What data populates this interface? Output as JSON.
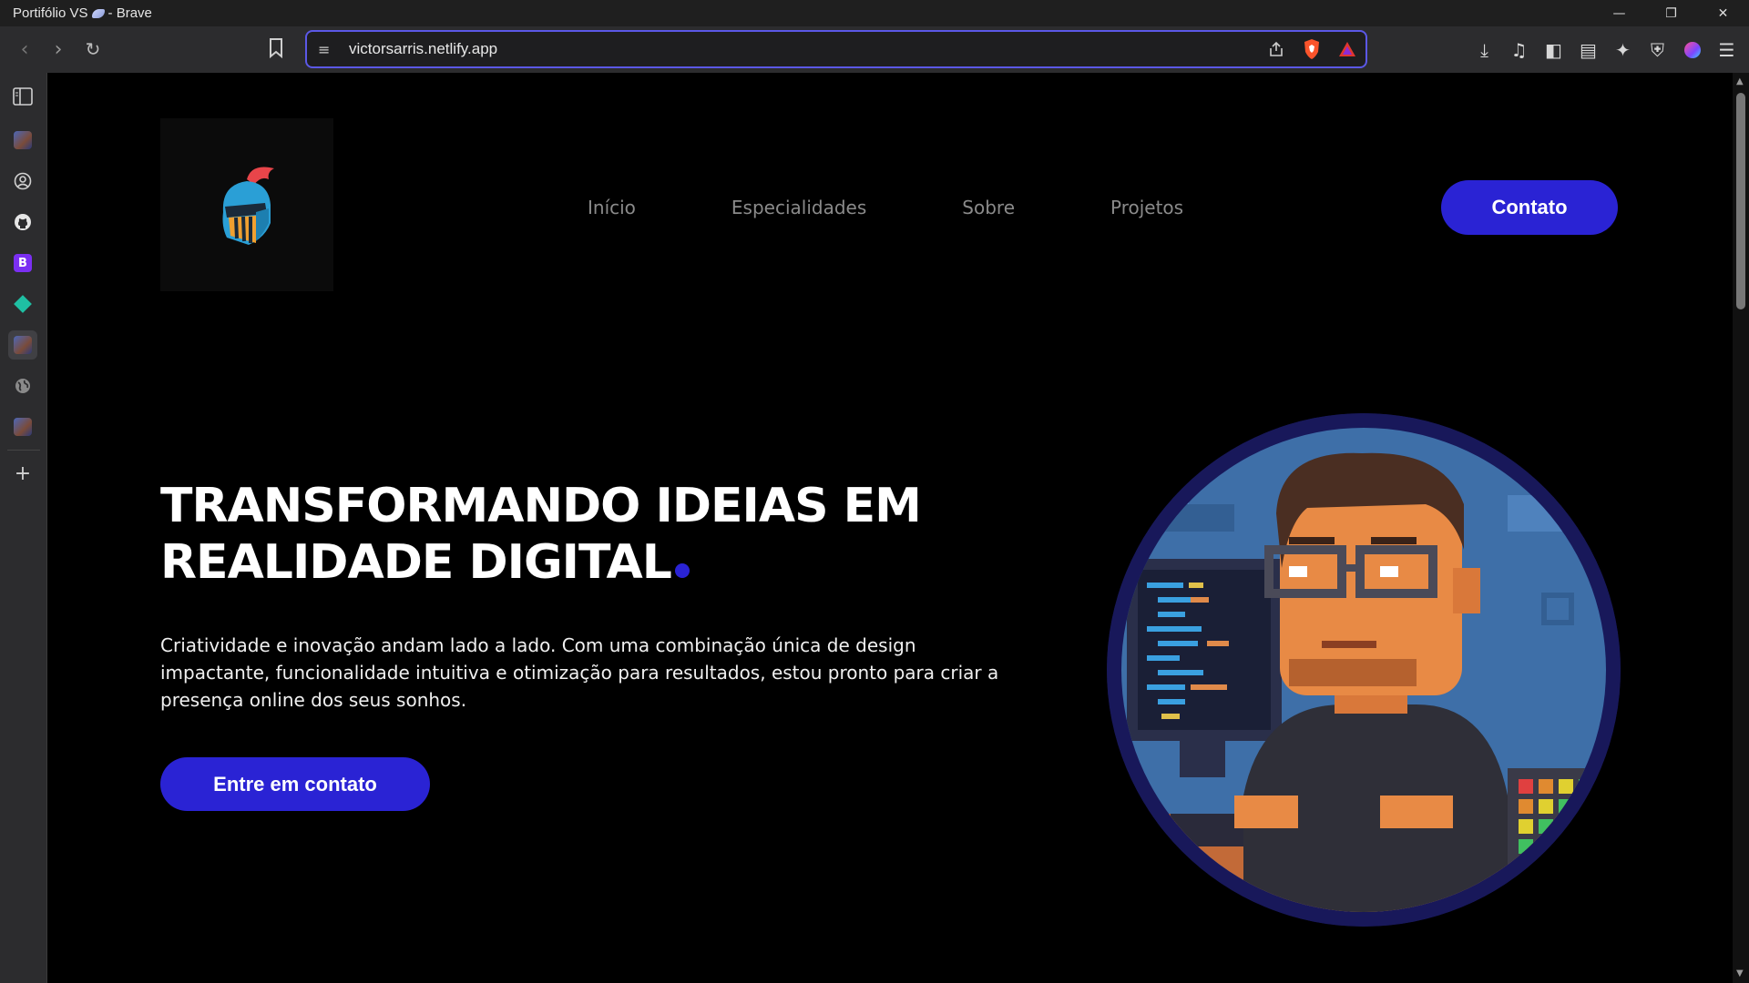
{
  "browser": {
    "window_title": "Portifólio VS",
    "app_name": "- Brave",
    "url": "victorsarris.netlify.app",
    "window_controls": [
      "minimize-icon",
      "restore-icon",
      "close-icon"
    ]
  },
  "toolbar": {
    "left_icons": [
      "back-icon",
      "forward-icon",
      "reload-icon",
      "bookmark-icon"
    ],
    "url_right_icons": [
      "share-icon",
      "brave-shields-icon",
      "brave-rewards-icon"
    ],
    "right_icons": [
      "download-icon",
      "media-icon",
      "sidebar-toggle-icon",
      "wallet-icon",
      "leo-ai-icon",
      "vpn-icon",
      "profile-icon",
      "menu-icon"
    ]
  },
  "sidebar": {
    "items": [
      "sidebar-panel-icon",
      "site-avatar-icon",
      "account-icon",
      "github-icon",
      "bootstrap-icon",
      "diamond-app-icon",
      "site-avatar-icon",
      "globe-icon",
      "site-avatar-icon",
      "add-icon"
    ]
  },
  "site": {
    "nav": {
      "links": [
        "Início",
        "Especialidades",
        "Sobre",
        "Projetos"
      ],
      "contact_button": "Contato"
    },
    "hero": {
      "title_line1": "TRANSFORMANDO IDEIAS EM",
      "title_line2": "REALIDADE DIGITAL",
      "description": "Criatividade e inovação andam lado a lado. Com uma combinação única de design impactante, funcionalidade intuitiva e otimização para resultados, estou pronto para criar a presença online dos seus sonhos.",
      "cta_button": "Entre em contato"
    },
    "colors": {
      "accent": "#2a23d4",
      "background": "#000000",
      "nav_link": "#8a8a8a",
      "avatar_ring": "#18185a"
    }
  }
}
